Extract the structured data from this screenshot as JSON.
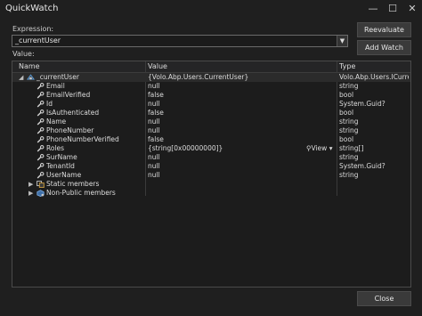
{
  "window": {
    "title": "QuickWatch",
    "minimize": "—",
    "maximize": "☐",
    "close": "✕"
  },
  "expression": {
    "label": "Expression:",
    "value": "_currentUser"
  },
  "buttons": {
    "reevaluate": "Reevaluate",
    "add_watch": "Add Watch",
    "close": "Close"
  },
  "value_label": "Value:",
  "grid": {
    "headers": {
      "name": "Name",
      "value": "Value",
      "type": "Type"
    },
    "rows": [
      {
        "name": "_currentUser",
        "value": "{Volo.Abp.Users.CurrentUser}",
        "type": "Volo.Abp.Users.ICurre",
        "indent": 0,
        "expander": "◢",
        "icon": "object"
      },
      {
        "name": "Email",
        "value": "null",
        "type": "string",
        "indent": 1,
        "expander": "",
        "icon": "wrench"
      },
      {
        "name": "EmailVerified",
        "value": "false",
        "type": "bool",
        "indent": 1,
        "expander": "",
        "icon": "wrench"
      },
      {
        "name": "Id",
        "value": "null",
        "type": "System.Guid?",
        "indent": 1,
        "expander": "",
        "icon": "wrench"
      },
      {
        "name": "IsAuthenticated",
        "value": "false",
        "type": "bool",
        "indent": 1,
        "expander": "",
        "icon": "wrench"
      },
      {
        "name": "Name",
        "value": "null",
        "type": "string",
        "indent": 1,
        "expander": "",
        "icon": "wrench"
      },
      {
        "name": "PhoneNumber",
        "value": "null",
        "type": "string",
        "indent": 1,
        "expander": "",
        "icon": "wrench"
      },
      {
        "name": "PhoneNumberVerified",
        "value": "false",
        "type": "bool",
        "indent": 1,
        "expander": "",
        "icon": "wrench"
      },
      {
        "name": "Roles",
        "value": "{string[0x00000000]}",
        "type": "string[]",
        "indent": 1,
        "expander": "",
        "icon": "wrench",
        "view": "View"
      },
      {
        "name": "SurName",
        "value": "null",
        "type": "string",
        "indent": 1,
        "expander": "",
        "icon": "wrench"
      },
      {
        "name": "TenantId",
        "value": "null",
        "type": "System.Guid?",
        "indent": 1,
        "expander": "",
        "icon": "wrench"
      },
      {
        "name": "UserName",
        "value": "null",
        "type": "string",
        "indent": 1,
        "expander": "",
        "icon": "wrench"
      },
      {
        "name": "Static members",
        "value": "",
        "type": "",
        "indent": 1,
        "expander": "▶",
        "icon": "static"
      },
      {
        "name": "Non-Public members",
        "value": "",
        "type": "",
        "indent": 1,
        "expander": "▶",
        "icon": "nonpublic"
      }
    ]
  },
  "colors": {
    "accent_icon": "#5b9bd5",
    "wrench": "#d4d4d4",
    "background": "#1f1f1f"
  }
}
